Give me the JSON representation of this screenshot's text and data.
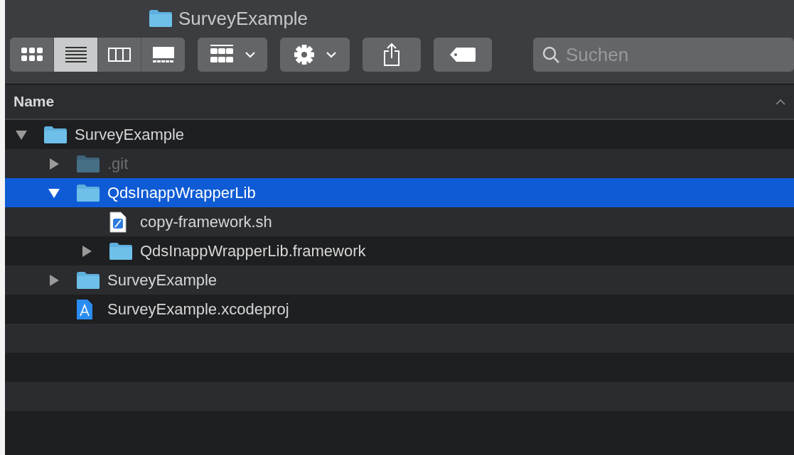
{
  "window": {
    "title": "SurveyExample"
  },
  "view_modes": [
    {
      "kind": "icons",
      "selected": false
    },
    {
      "kind": "list",
      "selected": true
    },
    {
      "kind": "columns",
      "selected": false
    },
    {
      "kind": "gallery",
      "selected": false
    }
  ],
  "toolbar": [
    {
      "kind": "group",
      "menu": true
    },
    {
      "kind": "action",
      "menu": true
    },
    {
      "kind": "share",
      "menu": false
    },
    {
      "kind": "tag",
      "menu": false
    }
  ],
  "search": {
    "placeholder": "Suchen"
  },
  "columns": [
    {
      "label": "Name",
      "sorted_ascending": true
    }
  ],
  "tree": [
    {
      "name": "SurveyExample",
      "kind": "folder",
      "expanded": true,
      "selected": false,
      "dimmed": false,
      "children": [
        {
          "name": ".git",
          "kind": "folder",
          "expanded": false,
          "selected": false,
          "dimmed": true
        },
        {
          "name": "QdsInappWrapperLib",
          "kind": "folder",
          "expanded": true,
          "selected": true,
          "dimmed": false,
          "children": [
            {
              "name": "copy-framework.sh",
              "kind": "script",
              "selected": false,
              "dimmed": false
            },
            {
              "name": "QdsInappWrapperLib.framework",
              "kind": "folder",
              "expanded": false,
              "selected": false,
              "dimmed": false
            }
          ]
        },
        {
          "name": "SurveyExample",
          "kind": "folder",
          "expanded": false,
          "selected": false,
          "dimmed": false
        },
        {
          "name": "SurveyExample.xcodeproj",
          "kind": "project",
          "selected": false,
          "dimmed": false
        }
      ]
    }
  ]
}
